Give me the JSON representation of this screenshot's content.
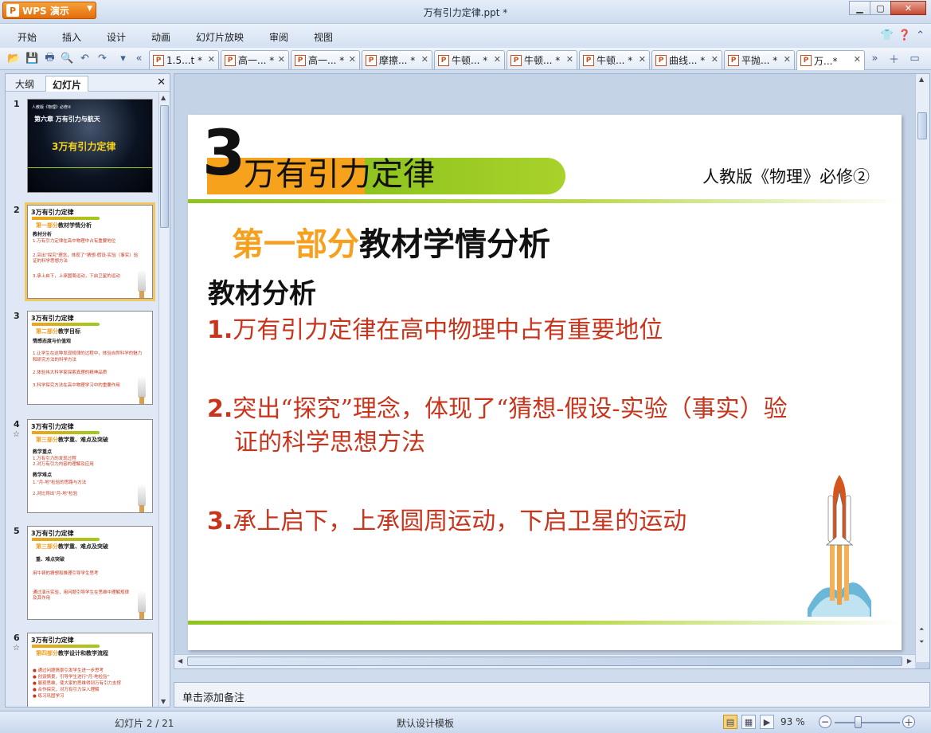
{
  "app": {
    "brand": "WPS 演示",
    "window_title": "万有引力定律.ppt *"
  },
  "menu": [
    "开始",
    "插入",
    "设计",
    "动画",
    "幻灯片放映",
    "审阅",
    "视图"
  ],
  "tabs": [
    {
      "label": "1.5...t *"
    },
    {
      "label": "高一... *"
    },
    {
      "label": "高一... *"
    },
    {
      "label": "摩擦... *"
    },
    {
      "label": "牛顿... *"
    },
    {
      "label": "牛顿... *"
    },
    {
      "label": "牛顿... *"
    },
    {
      "label": "曲线... *"
    },
    {
      "label": "平抛... *"
    },
    {
      "label": "万...*"
    }
  ],
  "left_panel": {
    "tab_outline": "大纲",
    "tab_slides": "幻灯片",
    "thumbs": [
      {
        "num": "1",
        "line1": "人教版《物理》必修②",
        "line2": "第六章   万有引力与航天",
        "title": "3万有引力定律"
      },
      {
        "num": "2",
        "title": "3万有引力定律",
        "part_a": "第一部分",
        "part_b": "教材学情分析",
        "sub": "教材分析",
        "lines": [
          "1.万有引力定律在高中物理中占有重要地位",
          "2.突出\"探究\"理念，体现了\"猜想-假设-实验（事实）验",
          "  证的科学思想方法",
          "3.承上启下，上承圆周运动，下启卫星的运动"
        ]
      },
      {
        "num": "3",
        "title": "3万有引力定律",
        "part_a": "第二部分",
        "part_b": "教学目标",
        "sub": "情感态度与价值观",
        "lines": [
          "1.让学生在这种发现规律的过程中，体验自然科学的魅力",
          "  和研究方法的科学方法",
          "2.体验伟大科学家探索真理的精神品质",
          "3.科学探究方法在高中物理学习中的重要作用"
        ]
      },
      {
        "num": "4",
        "mark": "☆",
        "title": "3万有引力定律",
        "part_a": "第三部分",
        "part_b": "教学重、难点及突破",
        "sub": "教学重点",
        "sub2": "教学难点",
        "lines": [
          "1.万有引力的发现过程",
          "2.对万有引力内容的理解及应用",
          "1.\"月-地\"检验的思路与方法",
          "2.对比得出\"月-地\"检验"
        ]
      },
      {
        "num": "5",
        "title": "3万有引力定律",
        "part_a": "第三部分",
        "part_b": "教学重、难点及突破",
        "sub": "重、难点突破",
        "lines": [
          "用牛顿的猜想和推理引导学生思考",
          "通过演示实验，用问题引导学生在思维中理解规律",
          "  及其作用"
        ]
      },
      {
        "num": "6",
        "mark": "☆",
        "title": "3万有引力定律",
        "part_a": "第四部分",
        "part_b": "教学设计和教学流程",
        "lines": [
          "● 通过问题情景引发学生进一步思考",
          "● 创设情景，引导学生进行\"月-地检验\"",
          "● 展现思维，使大家的思维得到万有引力支撑",
          "● 合作探究，对万有引力深入理解",
          "● 练习巩固学习"
        ]
      }
    ]
  },
  "slide": {
    "big_number": "3",
    "title": "万有引力定律",
    "subtitle": "人教版《物理》必修②",
    "heading_part": "第一部分",
    "heading_rest": "教材学情分析",
    "subheading": "教材分析",
    "items": [
      {
        "num": "1.",
        "text": "万有引力定律在高中物理中占有重要地位"
      },
      {
        "num": "2.",
        "text": "突出“探究”理念，体现了“猜想-假设-实验（事实）验",
        "text2": "证的科学思想方法"
      },
      {
        "num": "3.",
        "text": "承上启下，上承圆周运动，下启卫星的运动"
      }
    ]
  },
  "notes_placeholder": "单击添加备注",
  "status": {
    "slide_indicator": "幻灯片 2 / 21",
    "template": "默认设计模板",
    "zoom": "93 %"
  },
  "colors": {
    "accent_orange": "#f7a01d",
    "accent_green": "#8fc31f",
    "item_red": "#c8351c"
  }
}
